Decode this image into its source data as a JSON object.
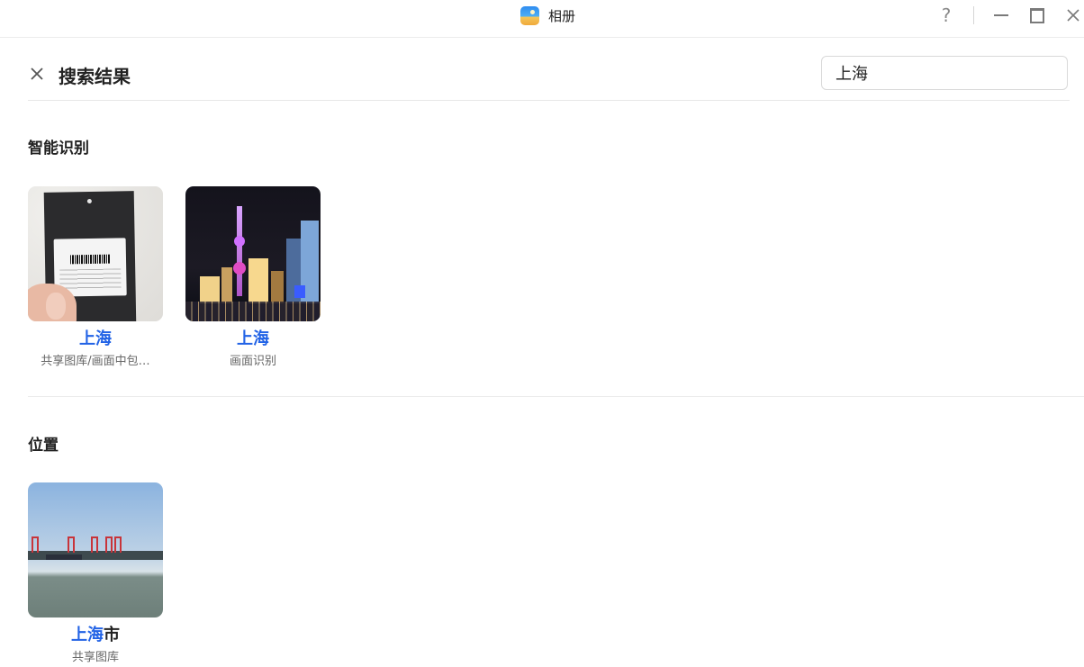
{
  "window": {
    "app_title": "相册",
    "help_icon": "question-icon",
    "minimize_icon": "minimize-icon",
    "maximize_icon": "maximize-icon",
    "close_icon": "close-icon"
  },
  "header": {
    "title": "搜索结果",
    "close_icon": "close-icon",
    "search_value": "上海"
  },
  "sections": [
    {
      "title": "智能识别",
      "items": [
        {
          "title_highlight": "上海",
          "title_rest": "",
          "subtitle": "共享图库/画面中包…",
          "thumbnail": "tag-in-hand"
        },
        {
          "title_highlight": "上海",
          "title_rest": "",
          "subtitle": "画面识别",
          "thumbnail": "night-skyline"
        }
      ]
    },
    {
      "title": "位置",
      "items": [
        {
          "title_highlight": "上海",
          "title_rest": "市",
          "subtitle": "共享图库",
          "thumbnail": "river-port"
        }
      ]
    }
  ],
  "colors": {
    "highlight": "#2263e6",
    "text": "#222222",
    "subtext": "#666666",
    "divider": "#ececec"
  }
}
